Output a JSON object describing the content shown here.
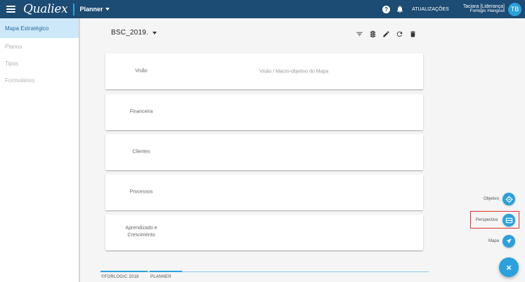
{
  "topbar": {
    "logo": "Qualiex",
    "module": "Planner",
    "help_glyph": "?",
    "updates_label": "ATUALIZAÇÕES",
    "user_name": "Taciara [Liderança]",
    "user_org": "Forlogic Hangout",
    "avatar_initials": "TB",
    "background_color": "#1c4b73"
  },
  "sidebar": {
    "items": [
      {
        "label": "Mapa Estratégico",
        "active": true
      },
      {
        "label": "Planos",
        "active": false
      },
      {
        "label": "Tipos",
        "active": false
      },
      {
        "label": "Formulários",
        "active": false
      }
    ]
  },
  "map": {
    "name": "BSC_2019.",
    "toolbar_icons": [
      "filter-icon",
      "traffic-light-icon",
      "pencil-icon",
      "refresh-icon",
      "trash-icon"
    ]
  },
  "cards": [
    {
      "label": "Visão",
      "description": "Visão / Macro-objetivo do Mapa"
    },
    {
      "label": "Financeira",
      "description": ""
    },
    {
      "label": "Clientes",
      "description": ""
    },
    {
      "label": "Processos",
      "description": ""
    },
    {
      "label_line1": "Aprendizado e",
      "label_line2": "Crescimento",
      "description": ""
    }
  ],
  "footer": {
    "copyright": "©FORLOGIC 2018",
    "product": "PLANNER"
  },
  "fab": {
    "objetivo_label": "Objetivo",
    "perspectiva_label": "Perspectiva",
    "mapa_label": "Mapa",
    "close_glyph": "×",
    "accent_color": "#2aa1dc",
    "highlight_color": "#e03131"
  }
}
